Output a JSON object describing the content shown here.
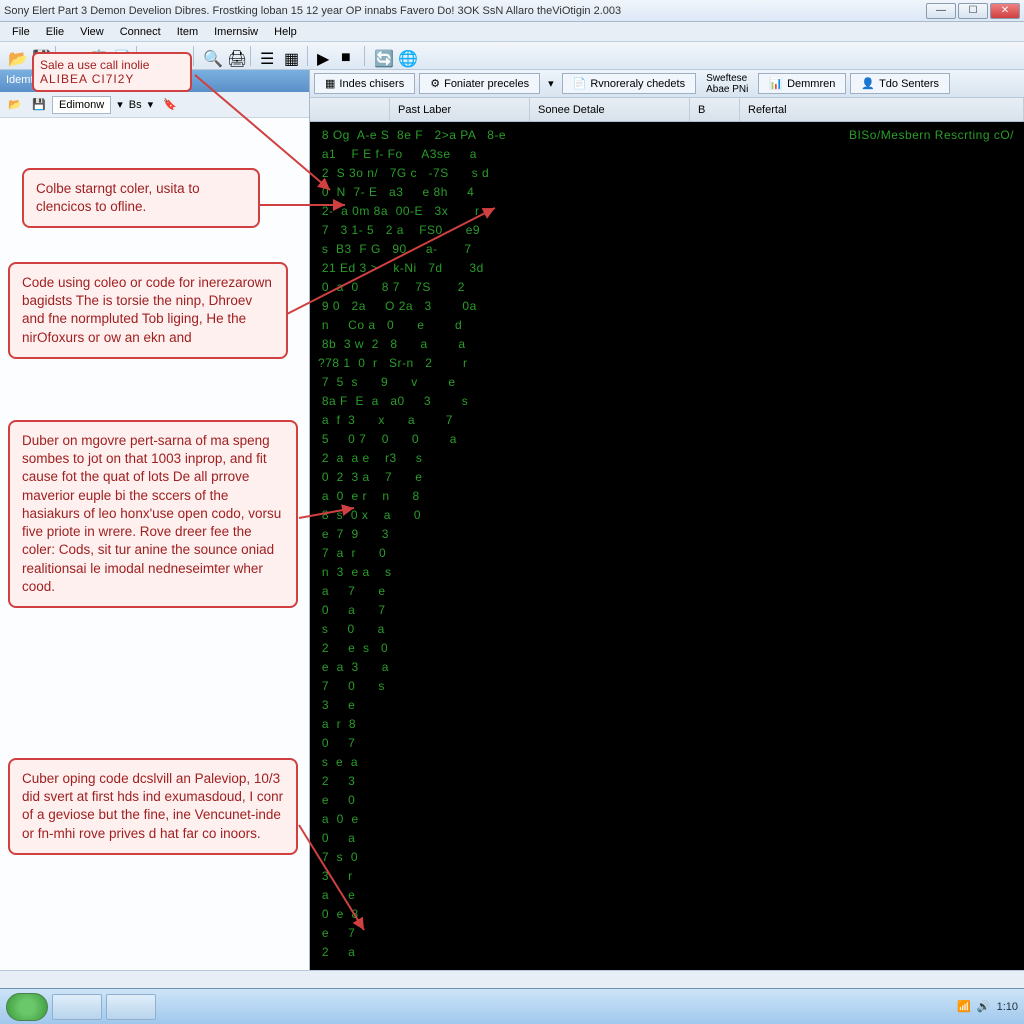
{
  "title": "Sony Elert Part 3 Demon Develion Dibres.  Frostking loban 15 12 year OP innabs Favero Do! 3OK SsN Allaro theViOtigin 2.003",
  "menu": [
    "File",
    "Elie",
    "View",
    "Connect",
    "Item",
    "Imernsiw",
    "Help"
  ],
  "toolbar_hint": {
    "line1": "Sale a use call inolie",
    "line2": "ALIBEA CI7I2Y"
  },
  "sidebar": {
    "title": "Idemting center",
    "dropdown": "Edimonw",
    "tb_label": "Bs"
  },
  "main_tabs": {
    "t1": "Indes chisers",
    "t2": "Foniater preceles",
    "t3": "Rvnoreraly chedets",
    "t4": "Demmren",
    "t5": "Tdo Senters",
    "side1": "Sweftese",
    "side2": "Abae PNi"
  },
  "columns": {
    "c1": "Past Laber",
    "c2": "Sonee Detale",
    "c3": "B",
    "c4": "Refertal"
  },
  "matrix_hint": "BISo/Mesbern Rescrting cO/",
  "callouts": {
    "a": "Colbe starngt coler, usita to clencicos to ofline.",
    "b": "Code using coleo or code for inerezarown bagidsts The is torsie the ninp, Dhroev and fne normpluted Tob liging, He the nirOfoxurs or ow an ekn and",
    "c": "Duber on mgovre pert-sarna of ma speng sombes to jot on that 1003 inprop, and fit cause fot the quat of lots De all prrove maverior euple bi the sccers of the hasiakurs of leo honx'use open codo, vorsu five priote in wrere. Rove dreer fee the coler: Cods, sit tur anine the sounce oniad realitionsai le imodal nedneseimter wher cood.",
    "d": "Cuber oping code dcslvill an Paleviop, 10/3 did svert at first hds ind exumasdoud, I conr of a geviose but the fine, ine Vencunet-inde or fn-mhi rove prives d hat far co inoors."
  },
  "tray_time": "1:10",
  "matrix_rows": [
    " 8 Og  A-e S  8e F   2>a PA   8-e",
    " a1    F E f- Fo     A3se     a",
    " 2  S 3o n/   7G c   -7S      s d",
    " 0  N  7- E   a3     e 8h     4",
    " 2-  a 0m 8a  00-E   3x       r",
    " 7   3 1- 5   2 a    FS0      e9",
    " s  B3  F G   90     a-       7",
    " 21 Ed 3 >    k-Ni   7d       3d",
    " 0  a  0      8 7    7S       2",
    " 9 0   2a     O 2a   3        0a",
    " n     Co a   0      e        d",
    " 8b  3 w  2   8      a        a",
    "?78 1  0  r   Sr-n   2        r",
    " 7  5  s      9      v        e",
    " 8a F  E  a   a0     3        s",
    " a  f  3      x      a        7",
    " 5     0 7    0      0        a",
    " 2  a  a e    r3     s",
    " 0  2  3 a    7      e",
    " a  0  e r    n      8",
    " 8  s  0 x    a      0",
    " e  7  9      3",
    " 7  a  r      0",
    " n  3  e a    s",
    " a     7      e",
    " 0     a      7",
    " s     0      a",
    " 2     e  s   0",
    " e  a  3      a",
    " 7     0      s",
    " 3     e",
    " a  r  8",
    " 0     7",
    " s  e  a",
    " 2     3",
    " e     0",
    " a  0  e",
    " 0     a",
    " 7  s  0",
    " 3     r",
    " a     e",
    " 0  e  8",
    " e     7",
    " 2     a"
  ]
}
